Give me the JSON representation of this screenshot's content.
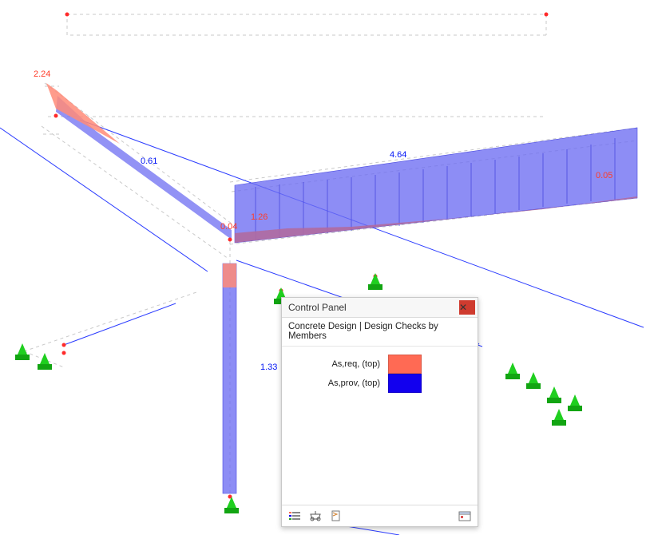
{
  "labels": {
    "v_224": "2.24",
    "v_061": "0.61",
    "v_004": "0.04",
    "v_126": "1.26",
    "v_464": "4.64",
    "v_005": "0.05",
    "v_133": "1.33"
  },
  "panel": {
    "title": "Control Panel",
    "close_glyph": "✕",
    "subtitle": "Concrete Design | Design Checks by Members",
    "legend": {
      "row1": {
        "label": "As,req, (top)",
        "color": "#ff6a54"
      },
      "row2": {
        "label": "As,prov, (top)",
        "color": "#1200ee"
      }
    }
  },
  "colors": {
    "req": "#ff6a54",
    "prov": "#1200ee",
    "diagram_blue": "#6d6df2",
    "diagram_red": "#ff8b78",
    "support_green": "#1fcf1f",
    "node_red": "#ff2a2a",
    "wire": "#c9c9c9",
    "wire_blue": "#2b3cff"
  }
}
